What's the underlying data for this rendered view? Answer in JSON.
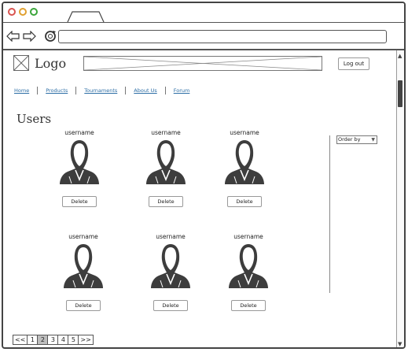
{
  "header": {
    "logo_label": "Logo",
    "logout_label": "Log out"
  },
  "menu": [
    "Home",
    "Products",
    "Tournaments",
    "About Us",
    "Forum"
  ],
  "page": {
    "title": "Users"
  },
  "users": [
    {
      "name": "username",
      "action": "Delete"
    },
    {
      "name": "username",
      "action": "Delete"
    },
    {
      "name": "username",
      "action": "Delete"
    },
    {
      "name": "username",
      "action": "Delete"
    },
    {
      "name": "username",
      "action": "Delete"
    },
    {
      "name": "username",
      "action": "Delete"
    }
  ],
  "sidebar": {
    "order_by": "Order by"
  },
  "pagination": {
    "pages": [
      "<<",
      "1",
      "2",
      "3",
      "4",
      "5",
      ">>"
    ],
    "active_index": 2
  },
  "icons": {
    "back": "arrow-left-icon",
    "forward": "arrow-right-icon",
    "refresh": "refresh-icon",
    "logo": "image-placeholder-icon",
    "avatar": "user-avatar-icon",
    "dropdown": "chevron-down-icon"
  }
}
